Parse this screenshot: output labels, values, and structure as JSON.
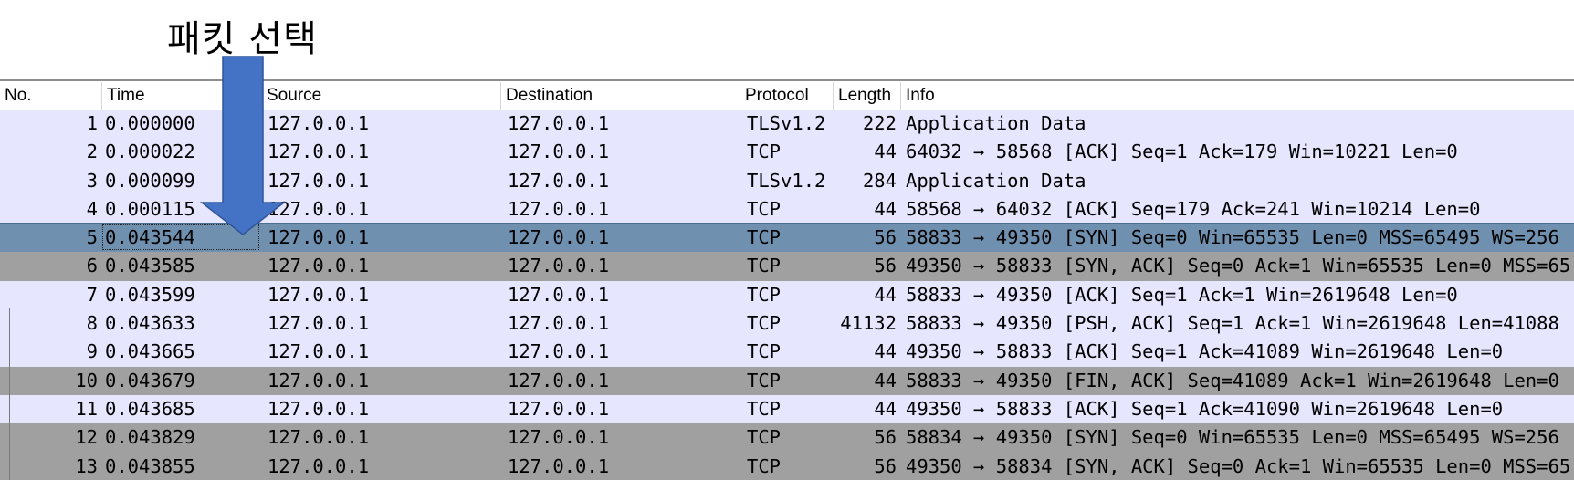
{
  "annotation": {
    "label": "패킷 선택"
  },
  "columns": {
    "no": "No.",
    "time": "Time",
    "source": "Source",
    "destination": "Destination",
    "protocol": "Protocol",
    "length": "Length",
    "info": "Info"
  },
  "packets": [
    {
      "no": "1",
      "time": "0.000000",
      "source": "127.0.0.1",
      "destination": "127.0.0.1",
      "protocol": "TLSv1.2",
      "length": "222",
      "info": "Application Data",
      "style": "tcp"
    },
    {
      "no": "2",
      "time": "0.000022",
      "source": "127.0.0.1",
      "destination": "127.0.0.1",
      "protocol": "TCP",
      "length": "44",
      "info": "64032 → 58568 [ACK] Seq=1 Ack=179 Win=10221 Len=0",
      "style": "tcp"
    },
    {
      "no": "3",
      "time": "0.000099",
      "source": "127.0.0.1",
      "destination": "127.0.0.1",
      "protocol": "TLSv1.2",
      "length": "284",
      "info": "Application Data",
      "style": "tcp"
    },
    {
      "no": "4",
      "time": "0.000115",
      "source": "127.0.0.1",
      "destination": "127.0.0.1",
      "protocol": "TCP",
      "length": "44",
      "info": "58568 → 64032 [ACK] Seq=179 Ack=241 Win=10214 Len=0",
      "style": "tcp"
    },
    {
      "no": "5",
      "time": "0.043544",
      "source": "127.0.0.1",
      "destination": "127.0.0.1",
      "protocol": "TCP",
      "length": "56",
      "info": "58833 → 49350 [SYN] Seq=0 Win=65535 Len=0 MSS=65495 WS=256",
      "style": "selected"
    },
    {
      "no": "6",
      "time": "0.043585",
      "source": "127.0.0.1",
      "destination": "127.0.0.1",
      "protocol": "TCP",
      "length": "56",
      "info": "49350 → 58833 [SYN, ACK] Seq=0 Ack=1 Win=65535 Len=0 MSS=65",
      "style": "fin"
    },
    {
      "no": "7",
      "time": "0.043599",
      "source": "127.0.0.1",
      "destination": "127.0.0.1",
      "protocol": "TCP",
      "length": "44",
      "info": "58833 → 49350 [ACK] Seq=1 Ack=1 Win=2619648 Len=0",
      "style": "tcp"
    },
    {
      "no": "8",
      "time": "0.043633",
      "source": "127.0.0.1",
      "destination": "127.0.0.1",
      "protocol": "TCP",
      "length": "41132",
      "info": "58833 → 49350 [PSH, ACK] Seq=1 Ack=1 Win=2619648 Len=41088",
      "style": "tcp"
    },
    {
      "no": "9",
      "time": "0.043665",
      "source": "127.0.0.1",
      "destination": "127.0.0.1",
      "protocol": "TCP",
      "length": "44",
      "info": "49350 → 58833 [ACK] Seq=1 Ack=41089 Win=2619648 Len=0",
      "style": "tcp"
    },
    {
      "no": "10",
      "time": "0.043679",
      "source": "127.0.0.1",
      "destination": "127.0.0.1",
      "protocol": "TCP",
      "length": "44",
      "info": "58833 → 49350 [FIN, ACK] Seq=41089 Ack=1 Win=2619648 Len=0",
      "style": "fin"
    },
    {
      "no": "11",
      "time": "0.043685",
      "source": "127.0.0.1",
      "destination": "127.0.0.1",
      "protocol": "TCP",
      "length": "44",
      "info": "49350 → 58833 [ACK] Seq=1 Ack=41090 Win=2619648 Len=0",
      "style": "tcp"
    },
    {
      "no": "12",
      "time": "0.043829",
      "source": "127.0.0.1",
      "destination": "127.0.0.1",
      "protocol": "TCP",
      "length": "56",
      "info": "58834 → 49350 [SYN] Seq=0 Win=65535 Len=0 MSS=65495 WS=256",
      "style": "fin"
    },
    {
      "no": "13",
      "time": "0.043855",
      "source": "127.0.0.1",
      "destination": "127.0.0.1",
      "protocol": "TCP",
      "length": "56",
      "info": "49350 → 58834 [SYN, ACK] Seq=0 Ack=1 Win=65535 Len=0 MSS=65",
      "style": "fin"
    }
  ],
  "colors": {
    "row_default": "#e7e6ff",
    "row_gray": "#a0a0a0",
    "row_selected": "#7090b0",
    "arrow": "#4472c4"
  },
  "icons": {
    "annotation_arrow": "down-arrow-icon"
  }
}
